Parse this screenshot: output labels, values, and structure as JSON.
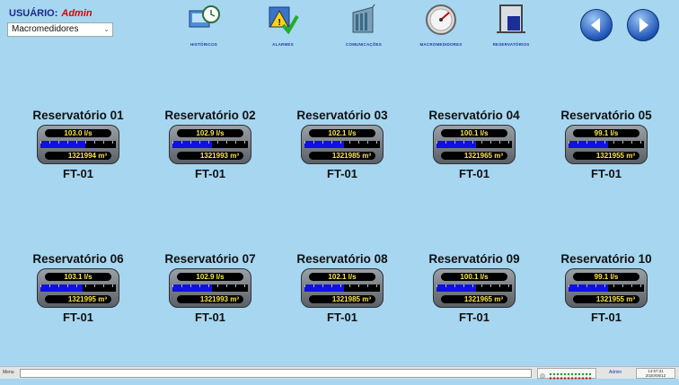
{
  "header": {
    "user_label": "USUÁRIO:",
    "user_name": "Admin",
    "selector_value": "Macromedidores"
  },
  "nav": [
    {
      "label": "HISTÓRICOS",
      "icon": "history-clock-icon"
    },
    {
      "label": "ALARMES",
      "icon": "alarm-warning-icon"
    },
    {
      "label": "COMUNICAÇÕES",
      "icon": "communication-panel-icon"
    },
    {
      "label": "MACROMEDIDORES",
      "icon": "gauge-meter-icon"
    },
    {
      "label": "RESERVATÓRIOS",
      "icon": "reservoir-tank-icon"
    }
  ],
  "arrows": {
    "back_icon": "back-arrow-icon",
    "forward_icon": "forward-arrow-icon"
  },
  "volume_unit": "m³",
  "reservoirs": [
    {
      "name": "Reservatório 01",
      "flow": "103.0  l/s",
      "level_pct": 60,
      "volume": "1321994",
      "tag": "FT-01"
    },
    {
      "name": "Reservatório 02",
      "flow": "102.9  l/s",
      "level_pct": 52,
      "volume": "1321993",
      "tag": "FT-01"
    },
    {
      "name": "Reservatório 03",
      "flow": "102.1  l/s",
      "level_pct": 52,
      "volume": "1321985",
      "tag": "FT-01"
    },
    {
      "name": "Reservatório 04",
      "flow": "100.1  l/s",
      "level_pct": 52,
      "volume": "1321965",
      "tag": "FT-01"
    },
    {
      "name": "Reservatório 05",
      "flow": "99.1  l/s",
      "level_pct": 52,
      "volume": "1321955",
      "tag": "FT-01"
    },
    {
      "name": "Reservatório 06",
      "flow": "103.1  l/s",
      "level_pct": 56,
      "volume": "1321995",
      "tag": "FT-01"
    },
    {
      "name": "Reservatório 07",
      "flow": "102.9  l/s",
      "level_pct": 52,
      "volume": "1321993",
      "tag": "FT-01"
    },
    {
      "name": "Reservatório 08",
      "flow": "102.1  l/s",
      "level_pct": 52,
      "volume": "1321985",
      "tag": "FT-01"
    },
    {
      "name": "Reservatório 09",
      "flow": "100.1  l/s",
      "level_pct": 52,
      "volume": "1321965",
      "tag": "FT-01"
    },
    {
      "name": "Reservatório 10",
      "flow": "99.1  l/s",
      "level_pct": 52,
      "volume": "1321955",
      "tag": "FT-01"
    }
  ],
  "statusbar": {
    "menu_label": "Menu",
    "user": "Admin",
    "time": "14:57:31",
    "date": "2020/08/12"
  },
  "colors": {
    "background": "#a6d6f0",
    "readout_text": "#ffe94a",
    "level_fill": "#1010e6",
    "username": "#e00000"
  }
}
